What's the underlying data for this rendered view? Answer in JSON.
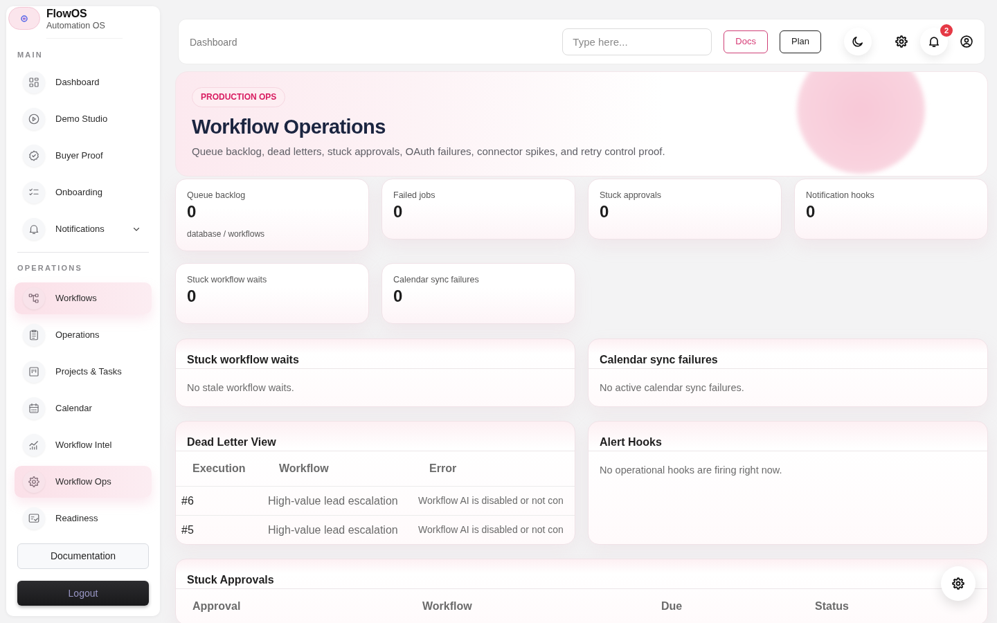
{
  "sidebar": {
    "brand": {
      "name": "FlowOS",
      "tagline": "Automation OS"
    },
    "sections": [
      {
        "title": "MAIN",
        "items": [
          {
            "label": "Dashboard",
            "kind": "link",
            "selected": false
          },
          {
            "label": "Demo Studio",
            "kind": "link",
            "selected": false
          },
          {
            "label": "Buyer Proof",
            "kind": "link",
            "selected": false
          },
          {
            "label": "Onboarding",
            "kind": "link",
            "selected": false
          },
          {
            "label": "Notifications",
            "kind": "group",
            "selected": false
          }
        ]
      },
      {
        "title": "OPERATIONS",
        "items": [
          {
            "label": "Workflows",
            "kind": "link",
            "selected": true
          },
          {
            "label": "Operations",
            "kind": "link",
            "selected": false
          },
          {
            "label": "Projects & Tasks",
            "kind": "link",
            "selected": false
          },
          {
            "label": "Calendar",
            "kind": "link",
            "selected": false
          },
          {
            "label": "Workflow Intel",
            "kind": "link",
            "selected": false
          },
          {
            "label": "Workflow Ops",
            "kind": "link",
            "selected": true
          },
          {
            "label": "Readiness",
            "kind": "link",
            "selected": false
          }
        ]
      }
    ],
    "buttons": [
      {
        "label": "Documentation",
        "kind": "outline"
      },
      {
        "label": "Logout",
        "kind": "dark"
      }
    ]
  },
  "header": {
    "breadcrumb": "Dashboard",
    "search": {
      "placeholder": "Type here..."
    },
    "buttons": [
      {
        "label": "Docs",
        "kind": "accent"
      },
      {
        "label": "Plan",
        "kind": "outline"
      }
    ],
    "notification_badge": "2"
  },
  "hero": {
    "badge": "PRODUCTION OPS",
    "title": "Workflow Operations",
    "subtitle": "Queue backlog, dead letters, stuck approvals, OAuth failures, connector spikes, and retry control proof."
  },
  "stats": [
    {
      "label": "Queue backlog",
      "value": "0",
      "note": "database / workflows"
    },
    {
      "label": "Failed jobs",
      "value": "0"
    },
    {
      "label": "Stuck approvals",
      "value": "0"
    },
    {
      "label": "Notification hooks",
      "value": "0"
    },
    {
      "label": "Stuck workflow waits",
      "value": "0"
    },
    {
      "label": "Calendar sync failures",
      "value": "0"
    }
  ],
  "panels": [
    {
      "title": "Stuck workflow waits",
      "kind": "message",
      "message": "No stale workflow waits."
    },
    {
      "title": "Calendar sync failures",
      "kind": "message",
      "message": "No active calendar sync failures."
    },
    {
      "title": "Dead Letter View",
      "kind": "table",
      "columns": [
        "Execution",
        "Workflow",
        "Error"
      ],
      "rows": [
        [
          "#6",
          "High-value lead escalation",
          "Workflow AI is disabled or not con"
        ],
        [
          "#5",
          "High-value lead escalation",
          "Workflow AI is disabled or not con"
        ]
      ]
    },
    {
      "title": "Alert Hooks",
      "kind": "message",
      "message": "No operational hooks are firing right now."
    },
    {
      "title": "Stuck Approvals",
      "kind": "table",
      "columns": [
        "Approval",
        "Workflow",
        "Due",
        "Status"
      ]
    }
  ]
}
